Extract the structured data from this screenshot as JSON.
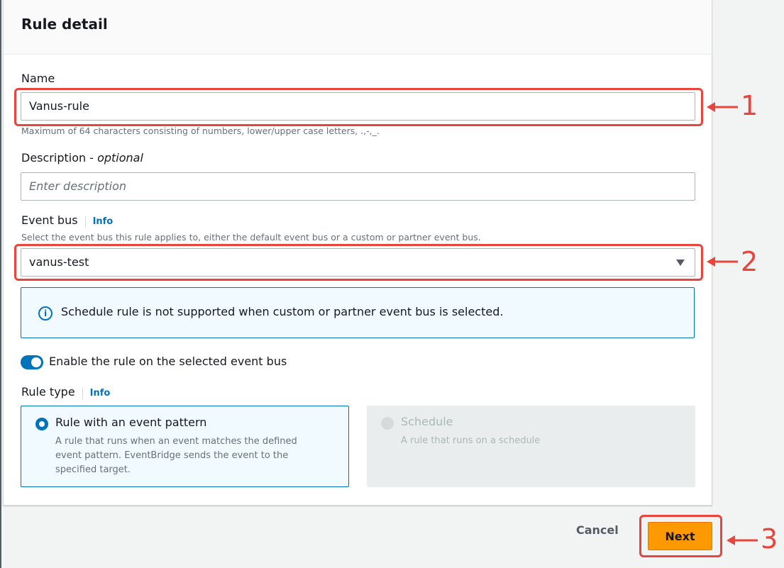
{
  "panel": {
    "title": "Rule detail"
  },
  "name_field": {
    "label": "Name",
    "value": "Vanus-rule",
    "hint": "Maximum of 64 characters consisting of numbers, lower/upper case letters, .,-,_."
  },
  "description_field": {
    "label": "Description - ",
    "label_optional": "optional",
    "placeholder": "Enter description"
  },
  "event_bus": {
    "label": "Event bus",
    "info": "Info",
    "hint": "Select the event bus this rule applies to, either the default event bus or a custom or partner event bus.",
    "selected": "vanus-test"
  },
  "alert": {
    "icon": "i",
    "text": "Schedule rule is not supported when custom or partner event bus is selected."
  },
  "toggle": {
    "label": "Enable the rule on the selected event bus",
    "enabled": true
  },
  "rule_type": {
    "label": "Rule type",
    "info": "Info",
    "options": [
      {
        "title": "Rule with an event pattern",
        "description": "A rule that runs when an event matches the defined event pattern. EventBridge sends the event to the specified target.",
        "selected": true,
        "disabled": false
      },
      {
        "title": "Schedule",
        "description": "A rule that runs on a schedule",
        "selected": false,
        "disabled": true
      }
    ]
  },
  "actions": {
    "cancel": "Cancel",
    "next": "Next"
  },
  "annotations": {
    "one": "1",
    "two": "2",
    "three": "3",
    "color": "#e8453c"
  }
}
